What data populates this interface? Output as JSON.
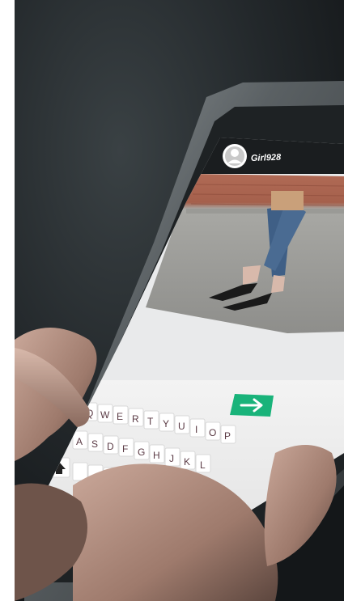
{
  "chat": {
    "contact_name": "Girl928",
    "avatar_icon": "user-avatar-icon",
    "image_description_icon": "photo-message",
    "send_icon": "arrow-right-icon"
  },
  "keyboard": {
    "row1": [
      "Q",
      "W",
      "E",
      "R",
      "T",
      "Y",
      "U",
      "I",
      "O",
      "P"
    ],
    "row2": [
      "A",
      "S",
      "D",
      "F",
      "G",
      "H",
      "J",
      "K",
      "L"
    ],
    "shift_icon": "shift-up-icon"
  },
  "colors": {
    "send_button": "#19b37a",
    "header_bg": "#1a1d1f",
    "phone_frame": "#6a6f72",
    "screen_bg": "#e9eaeb",
    "key_text": "#5a3a44"
  }
}
